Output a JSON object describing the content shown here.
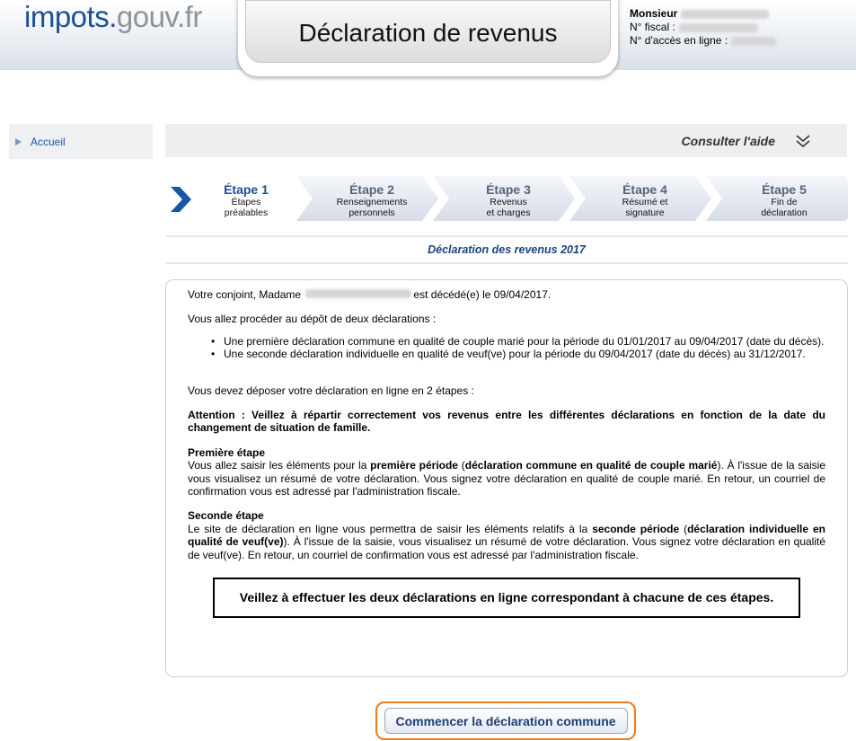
{
  "header": {
    "logo_part1": "impots.",
    "logo_part2": "gouv.fr",
    "title": "Déclaration de revenus",
    "ident": {
      "civility": "Monsieur",
      "fiscal_label": "N° fiscal :",
      "access_label": "N° d'accès en ligne :"
    }
  },
  "sidebar": {
    "items": [
      {
        "label": "Accueil",
        "icon": "triangle-right-icon"
      }
    ]
  },
  "help": {
    "label": "Consulter l'aide",
    "icon": "double-chevron-down-icon"
  },
  "steps": [
    {
      "title": "Étape 1",
      "line1": "Étapes",
      "line2": "préalables",
      "current": true
    },
    {
      "title": "Étape 2",
      "line1": "Renseignements",
      "line2": "personnels",
      "current": false
    },
    {
      "title": "Étape 3",
      "line1": "Revenus",
      "line2": "et charges",
      "current": false
    },
    {
      "title": "Étape 4",
      "line1": "Résumé et",
      "line2": "signature",
      "current": false
    },
    {
      "title": "Étape 5",
      "line1": "Fin de",
      "line2": "déclaration",
      "current": false
    }
  ],
  "section_title": "Déclaration des revenus 2017",
  "content": {
    "intro_prefix": "Votre conjoint, Madame",
    "intro_suffix": "est décédé(e) le 09/04/2017.",
    "procedure": "Vous allez procéder au dépôt de deux déclarations :",
    "bullets": [
      "Une première déclaration commune en qualité de couple marié pour la période du 01/01/2017 au 09/04/2017 (date du décès).",
      "Une seconde déclaration individuelle en qualité de veuf(ve) pour la période du 09/04/2017 (date du décès) au 31/12/2017."
    ],
    "two_steps": "Vous devez déposer votre déclaration en ligne en 2 étapes :",
    "attention": "Attention : Veillez à répartir correctement vos revenus entre les différentes déclarations en fonction de la date du changement de situation de famille.",
    "first_step_title": "Première étape",
    "first_step_a": "Vous allez saisir les éléments pour la",
    "first_step_b": "première période",
    "first_step_c": "(",
    "first_step_d": "déclaration commune en qualité de couple marié",
    "first_step_e": "). À l'issue de la saisie vous visualisez un résumé de votre déclaration. Vous signez votre déclaration en qualité de couple marié. En retour, un courriel de confirmation vous est adressé par l'administration fiscale.",
    "second_step_title": "Seconde étape",
    "second_step_a": "Le site de déclaration en ligne vous permettra de saisir les éléments relatifs à la",
    "second_step_b": "seconde période",
    "second_step_c": "(",
    "second_step_d": "déclaration individuelle en qualité de veuf(ve)",
    "second_step_e": "). À l'issue de la saisie, vous visualisez un résumé de votre déclaration. Vous signez votre déclaration en qualité de veuf(ve). En retour, un courriel de confirmation vous est adressé par l'administration fiscale.",
    "notice": "Veillez à effectuer les deux déclarations en ligne correspondant à chacune de ces étapes."
  },
  "cta": {
    "label": "Commencer la déclaration commune"
  },
  "colors": {
    "brand_blue": "#1f4f95",
    "step_current": "#1a4f95",
    "cta_focus": "#f07a1e"
  }
}
